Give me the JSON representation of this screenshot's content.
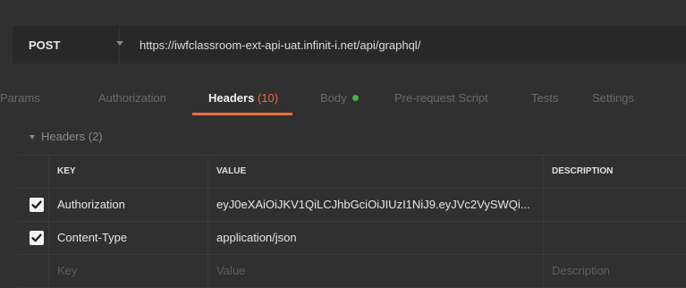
{
  "request": {
    "method": "POST",
    "url": "https://iwfclassroom-ext-api-uat.infinit-i.net/api/graphql/"
  },
  "tabs": [
    {
      "label": "Params"
    },
    {
      "label": "Authorization"
    },
    {
      "label": "Headers",
      "count": "(10)"
    },
    {
      "label": "Body"
    },
    {
      "label": "Pre-request Script"
    },
    {
      "label": "Tests"
    },
    {
      "label": "Settings"
    }
  ],
  "headers_section": {
    "title": "Headers (2)"
  },
  "table": {
    "columns": {
      "key": "KEY",
      "value": "VALUE",
      "description": "DESCRIPTION"
    },
    "rows": [
      {
        "checked": true,
        "key": "Authorization",
        "value": "eyJ0eXAiOiJKV1QiLCJhbGciOiJIUzI1NiJ9.eyJVc2VySWQi...",
        "description": ""
      },
      {
        "checked": true,
        "key": "Content-Type",
        "value": "application/json",
        "description": ""
      }
    ],
    "placeholders": {
      "key": "Key",
      "value": "Value",
      "description": "Description"
    }
  },
  "colors": {
    "accent": "#f26b3a",
    "body_dot": "#47b247",
    "background": "#303030"
  }
}
